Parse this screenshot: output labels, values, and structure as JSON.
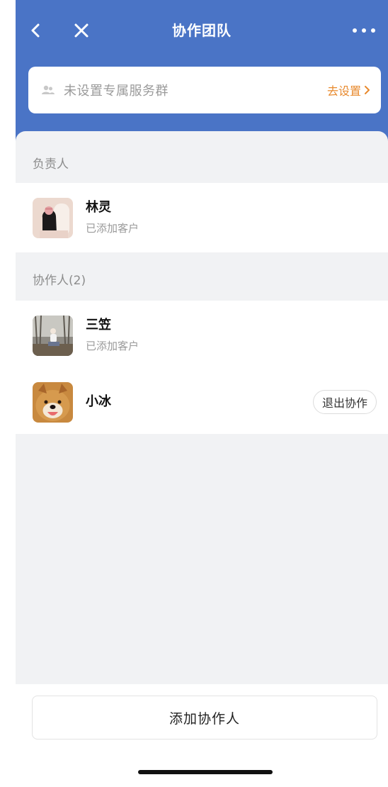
{
  "nav": {
    "title": "协作团队",
    "back_icon": "chevron-left-icon",
    "close_icon": "close-icon",
    "more_icon": "more-dots-icon"
  },
  "group_card": {
    "text": "未设置专属服务群",
    "action": "去设置"
  },
  "sections": {
    "owner_label": "负责人",
    "collaborators_label": "协作人(2)"
  },
  "owner": {
    "name": "林灵",
    "status": "已添加客户"
  },
  "collaborators": [
    {
      "name": "三笠",
      "status": "已添加客户"
    },
    {
      "name": "小冰",
      "action": "退出协作"
    }
  ],
  "footer": {
    "add_label": "添加协作人"
  },
  "colors": {
    "header": "#4a74c6",
    "accent_orange": "#e88a2e",
    "background_gray": "#f1f2f4"
  }
}
